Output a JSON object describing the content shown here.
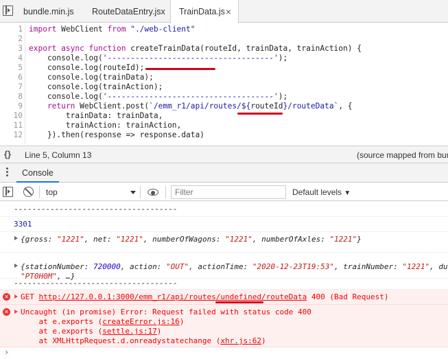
{
  "tabs": [
    {
      "label": "bundle.min.js",
      "active": false
    },
    {
      "label": "RouteDataEntry.jsx",
      "active": false
    },
    {
      "label": "TrainData.js",
      "active": true
    }
  ],
  "tab_close_glyph": "×",
  "editor": {
    "line_numbers": [
      "1",
      "2",
      "3",
      "4",
      "5",
      "6",
      "7",
      "8",
      "9",
      "10",
      "11",
      "12"
    ],
    "lines": {
      "l1_kw1": "import",
      "l1_name": " WebClient ",
      "l1_kw2": "from",
      "l1_str": " \"./web-client\"",
      "l3_kw": "export async function",
      "l3_rest": " createTrainData(routeId, trainData, trainAction) {",
      "l4_pre": "    console.log(",
      "l4_str": "'------------------------------------'",
      "l4_post": ");",
      "l5": "    console.log(routeId);",
      "l6": "    console.log(trainData);",
      "l7": "    console.log(trainAction);",
      "l8_pre": "    console.log(",
      "l8_str": "'------------------------------------'",
      "l8_post": ");",
      "l9_kw": "    return",
      "l9_mid": " WebClient.post(",
      "l9_str1": "`/emm_r1/api/routes/${",
      "l9_var": "routeId",
      "l9_str2": "}/routeData`",
      "l9_post": ", {",
      "l10": "        trainData: trainData,",
      "l11": "        trainAction: trainAction,",
      "l12": "    }).then(response => response.data)"
    }
  },
  "status": {
    "braces": "{}",
    "position": "Line 5, Column 13",
    "source_map": "(source mapped from bun"
  },
  "drawer": {
    "tab": "Console"
  },
  "toolbar": {
    "context": "top",
    "filter_placeholder": "Filter",
    "levels": "Default levels"
  },
  "console": {
    "dashes1": "------------------------------------",
    "route_id": "3301",
    "obj1": {
      "open": "{",
      "k1": "gross",
      "v1": "\"1221\"",
      "k2": "net",
      "v2": "\"1221\"",
      "k3": "numberOfWagons",
      "v3": "\"1221\"",
      "k4": "numberOfAxles",
      "v4": "\"1221\"",
      "close": "}"
    },
    "obj2": {
      "open": "{",
      "k1": "stationNumber",
      "v1": "720000",
      "k2": "action",
      "v2": "\"OUT\"",
      "k3": "actionTime",
      "v3": "\"2020-12-23T19:53\"",
      "k4": "trainNumber",
      "v4": "\"1221\"",
      "k5": "du",
      "line2_str": "\"PT0H0M\"",
      "line2_rest": ", …}"
    },
    "dashes2": "------------------------------------",
    "error1": {
      "method": "GET",
      "url": "http://127.0.0.1:3000/emm_r1/api/routes/undefined/routeData",
      "status": " 400 (Bad Request)"
    },
    "error2": {
      "line1": "Uncaught (in promise) Error: Request failed with status code 400",
      "line2_pre": "    at e.exports (",
      "line2_link": "createError.js:16",
      "line2_post": ")",
      "line3_pre": "    at e.exports (",
      "line3_link": "settle.js:17",
      "line3_post": ")",
      "line4_pre": "    at XMLHttpRequest.d.onreadystatechange (",
      "line4_link": "xhr.js:62",
      "line4_post": ")"
    },
    "prompt": "›"
  },
  "colors": {
    "annotation": "#d0021b",
    "error_bg": "#fff0f0",
    "error_text": "#ee0000",
    "active_tab_underline": "#1a73e8"
  }
}
